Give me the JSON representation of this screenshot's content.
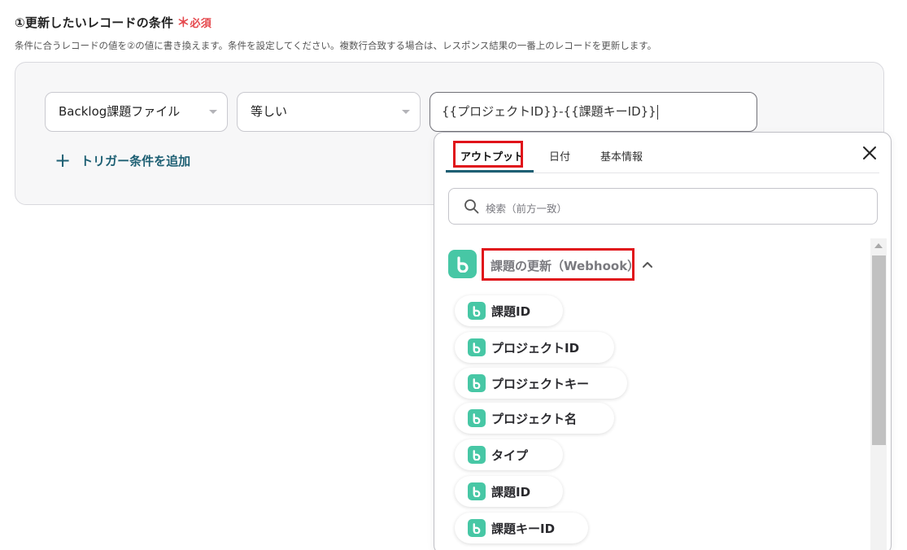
{
  "section": {
    "title": "①更新したいレコードの条件",
    "required_mark": "＊",
    "required_label": "必須",
    "description": "条件に合うレコードの値を②の値に書き換えます。条件を設定してください。複数行合致する場合は、レスポンス結果の一番上のレコードを更新します。"
  },
  "condition": {
    "field_select": "Backlog課題ファイル",
    "operator_select": "等しい",
    "value_input": "{{プロジェクトID}}-{{課題キーID}}",
    "add_trigger_label": "トリガー条件を追加"
  },
  "popup": {
    "tabs": [
      {
        "label": "アウトプット",
        "active": true
      },
      {
        "label": "日付",
        "active": false
      },
      {
        "label": "基本情報",
        "active": false
      }
    ],
    "search_placeholder": "検索（前方一致）",
    "group_title": "課題の更新（Webhook）",
    "items": [
      {
        "label": "課題ID"
      },
      {
        "label": "プロジェクトID"
      },
      {
        "label": "プロジェクトキー"
      },
      {
        "label": "プロジェクト名"
      },
      {
        "label": "タイプ"
      },
      {
        "label": "課題ID"
      },
      {
        "label": "課題キーID"
      }
    ]
  },
  "colors": {
    "accent": "#1d5f73",
    "required": "#e5484d",
    "highlight": "#e0131a",
    "app_logo": "#47c7a5"
  }
}
